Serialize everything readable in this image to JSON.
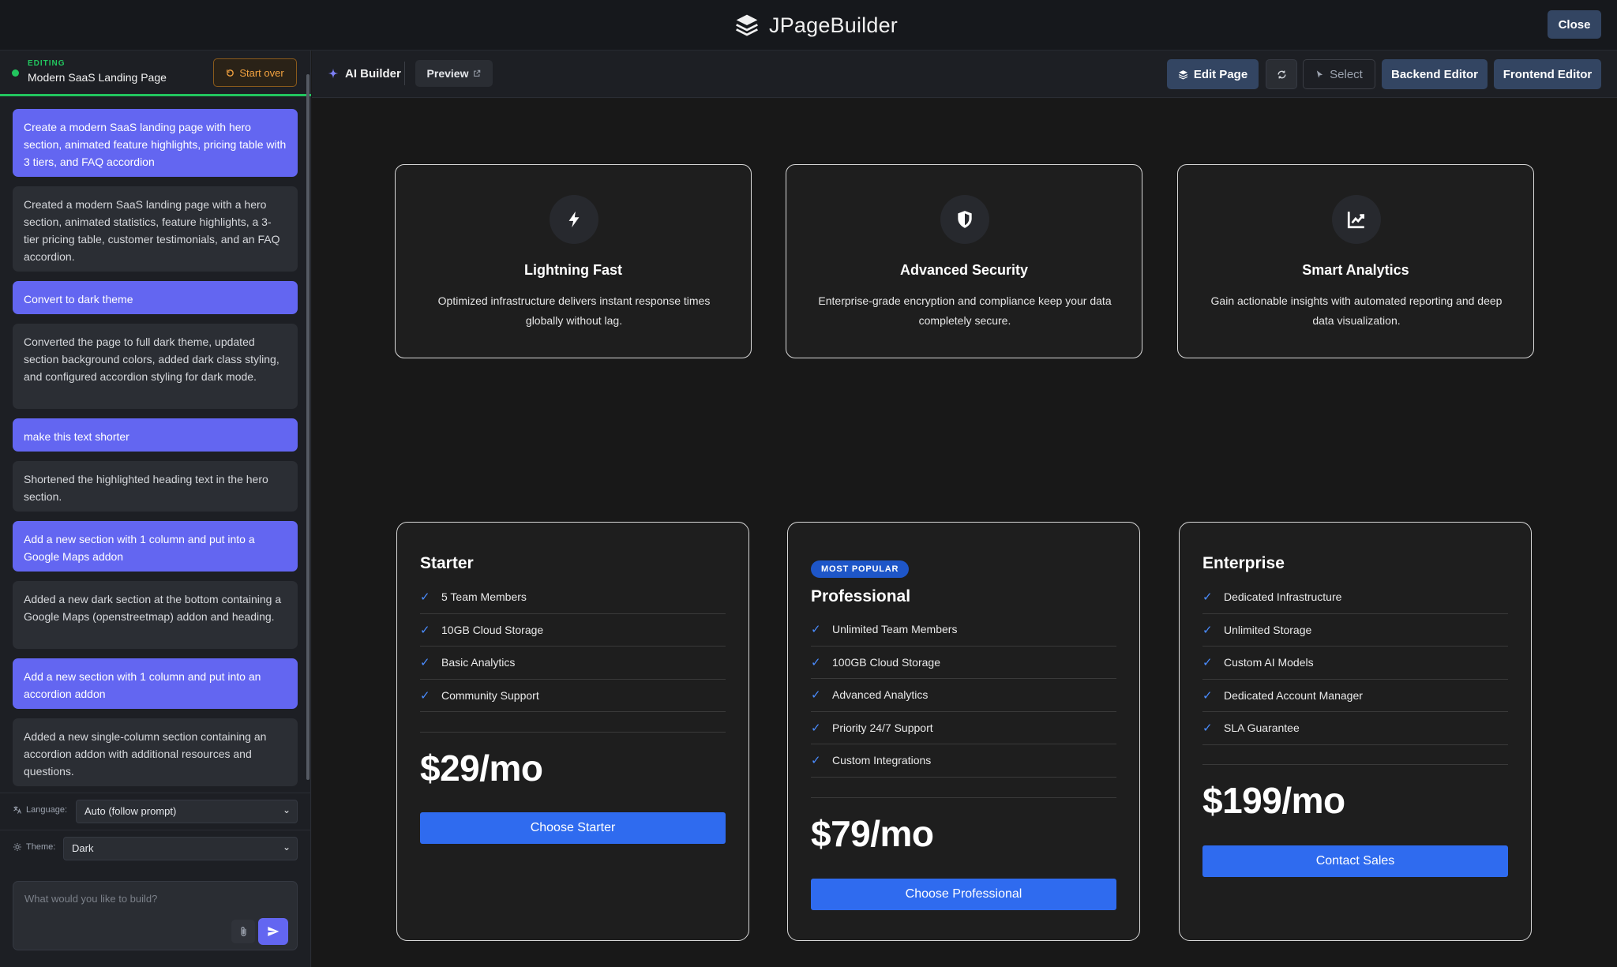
{
  "app": {
    "title": "JPageBuilder",
    "close_label": "Close"
  },
  "sidebar": {
    "editing_label": "EDITING",
    "page_title": "Modern SaaS Landing Page",
    "start_over_label": "Start over",
    "messages": [
      {
        "role": "user",
        "text": "Create a modern SaaS landing page with hero section, animated feature highlights, pricing table with 3 tiers, and FAQ accordion"
      },
      {
        "role": "assistant",
        "text": "Created a modern SaaS landing page with a hero section, animated statistics, feature highlights, a 3-tier pricing table, customer testimonials, and an FAQ accordion."
      },
      {
        "role": "user",
        "text": "Convert to dark theme"
      },
      {
        "role": "assistant",
        "text": "Converted the page to full dark theme, updated section background colors, added dark class styling, and configured accordion styling for dark mode."
      },
      {
        "role": "user",
        "text": "make this text shorter"
      },
      {
        "role": "assistant",
        "text": "Shortened the highlighted heading text in the hero section."
      },
      {
        "role": "user",
        "text": "Add a new section with 1 column and put into a Google Maps addon"
      },
      {
        "role": "assistant",
        "text": "Added a new dark section at the bottom containing a Google Maps (openstreetmap) addon and heading."
      },
      {
        "role": "user",
        "text": "Add a new section with 1 column and put into an accordion addon"
      },
      {
        "role": "assistant",
        "text": "Added a new single-column section containing an accordion addon with additional resources and questions."
      }
    ],
    "language_label": "Language:",
    "language_value": "Auto (follow prompt)",
    "theme_label": "Theme:",
    "theme_value": "Dark",
    "prompt_placeholder": "What would you like to build?"
  },
  "toolbar": {
    "ai_builder_label": "AI Builder",
    "preview_label": "Preview",
    "edit_page_label": "Edit Page",
    "select_label": "Select",
    "backend_editor_label": "Backend Editor",
    "frontend_editor_label": "Frontend Editor"
  },
  "features": [
    {
      "icon": "lightning-icon",
      "title": "Lightning Fast",
      "desc": "Optimized infrastructure delivers instant response times globally without lag."
    },
    {
      "icon": "shield-icon",
      "title": "Advanced Security",
      "desc": "Enterprise-grade encryption and compliance keep your data completely secure."
    },
    {
      "icon": "chart-icon",
      "title": "Smart Analytics",
      "desc": "Gain actionable insights with automated reporting and deep data visualization."
    }
  ],
  "pricing": [
    {
      "name": "Starter",
      "badge": "",
      "features": [
        "5 Team Members",
        "10GB Cloud Storage",
        "Basic Analytics",
        "Community Support"
      ],
      "price": "$29/mo",
      "cta": "Choose Starter"
    },
    {
      "name": "Professional",
      "badge": "MOST POPULAR",
      "features": [
        "Unlimited Team Members",
        "100GB Cloud Storage",
        "Advanced Analytics",
        "Priority 24/7 Support",
        "Custom Integrations"
      ],
      "price": "$79/mo",
      "cta": "Choose Professional"
    },
    {
      "name": "Enterprise",
      "badge": "",
      "features": [
        "Dedicated Infrastructure",
        "Unlimited Storage",
        "Custom AI Models",
        "Dedicated Account Manager",
        "SLA Guarantee"
      ],
      "price": "$199/mo",
      "cta": "Contact Sales"
    }
  ],
  "colors": {
    "accent": "#6366f1",
    "editing": "#22c55e",
    "cta": "#2f6bef",
    "toolbar_button": "#334562"
  }
}
